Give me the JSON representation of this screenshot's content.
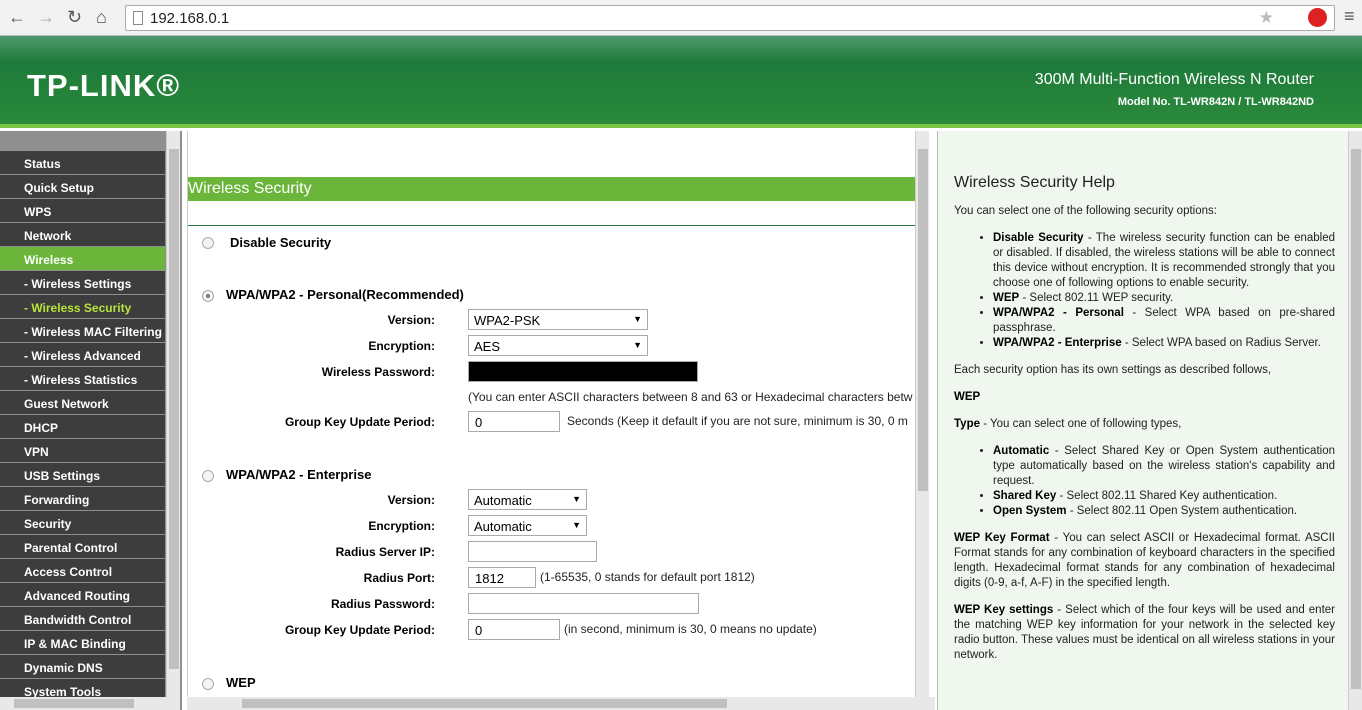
{
  "browser": {
    "url": "192.168.0.1"
  },
  "header": {
    "logo": "TP-LINK®",
    "product": "300M Multi-Function Wireless N Router",
    "model": "Model No. TL-WR842N / TL-WR842ND"
  },
  "sidebar": {
    "items": [
      {
        "label": "Status"
      },
      {
        "label": "Quick Setup"
      },
      {
        "label": "WPS"
      },
      {
        "label": "Network"
      },
      {
        "label": "Wireless"
      },
      {
        "label": "- Wireless Settings"
      },
      {
        "label": "- Wireless Security"
      },
      {
        "label": "- Wireless MAC Filtering"
      },
      {
        "label": "- Wireless Advanced"
      },
      {
        "label": "- Wireless Statistics"
      },
      {
        "label": "Guest Network"
      },
      {
        "label": "DHCP"
      },
      {
        "label": "VPN"
      },
      {
        "label": "USB Settings"
      },
      {
        "label": "Forwarding"
      },
      {
        "label": "Security"
      },
      {
        "label": "Parental Control"
      },
      {
        "label": "Access Control"
      },
      {
        "label": "Advanced Routing"
      },
      {
        "label": "Bandwidth Control"
      },
      {
        "label": "IP & MAC Binding"
      },
      {
        "label": "Dynamic DNS"
      },
      {
        "label": "System Tools"
      }
    ]
  },
  "main": {
    "title": "Wireless Security",
    "disable": "Disable Security",
    "personal": {
      "title": "WPA/WPA2 - Personal(Recommended)",
      "version_label": "Version:",
      "version": "WPA2-PSK",
      "encryption_label": "Encryption:",
      "encryption": "AES",
      "password_label": "Wireless Password:",
      "password_note": "(You can enter ASCII characters between 8 and 63 or Hexadecimal characters betw",
      "gkup_label": "Group Key Update Period:",
      "gkup": "0",
      "gkup_note": "Seconds (Keep it default if you are not sure, minimum is 30, 0 m"
    },
    "enterprise": {
      "title": "WPA/WPA2 - Enterprise",
      "version_label": "Version:",
      "version": "Automatic",
      "encryption_label": "Encryption:",
      "encryption": "Automatic",
      "radius_ip_label": "Radius Server IP:",
      "radius_ip": "",
      "radius_port_label": "Radius Port:",
      "radius_port": "1812",
      "radius_port_note": "(1-65535, 0 stands for default port 1812)",
      "radius_pw_label": "Radius Password:",
      "radius_pw": "",
      "gkup_label": "Group Key Update Period:",
      "gkup": "0",
      "gkup_note": "(in second, minimum is 30, 0 means no update)"
    },
    "wep": "WEP"
  },
  "help": {
    "title": "Wireless Security Help",
    "intro": "You can select one of the following security options:",
    "opts": [
      {
        "k": "Disable Security",
        "t": " - The wireless security function can be enabled or disabled. If disabled, the wireless stations will be able to connect this device without encryption. It is recommended strongly that you choose one of following options to enable security."
      },
      {
        "k": "WEP",
        "t": " - Select 802.11 WEP security."
      },
      {
        "k": "WPA/WPA2 - Personal",
        "t": " - Select WPA based on pre-shared passphrase."
      },
      {
        "k": "WPA/WPA2 - Enterprise",
        "t": " - Select WPA based on Radius Server."
      }
    ],
    "each": "Each security option has its own settings as described follows,",
    "wep": "WEP",
    "type_k": "Type",
    "type_t": " - You can select one of following types,",
    "types": [
      {
        "k": "Automatic",
        "t": " - Select Shared Key or Open System authentication type automatically based on the wireless station's capability and request."
      },
      {
        "k": "Shared Key",
        "t": " - Select 802.11 Shared Key authentication."
      },
      {
        "k": "Open System",
        "t": " - Select 802.11 Open System authentication."
      }
    ],
    "fmt_k": "WEP Key Format",
    "fmt_t": " - You can select ASCII or Hexadecimal format. ASCII Format stands for any combination of keyboard characters in the specified length. Hexadecimal format stands for any combination of hexadecimal digits (0-9, a-f, A-F) in the specified length.",
    "set_k": "WEP Key settings",
    "set_t": " - Select which of the four keys will be used and enter the matching WEP key information for your network in the selected key radio button. These values must be identical on all wireless stations in your network."
  }
}
